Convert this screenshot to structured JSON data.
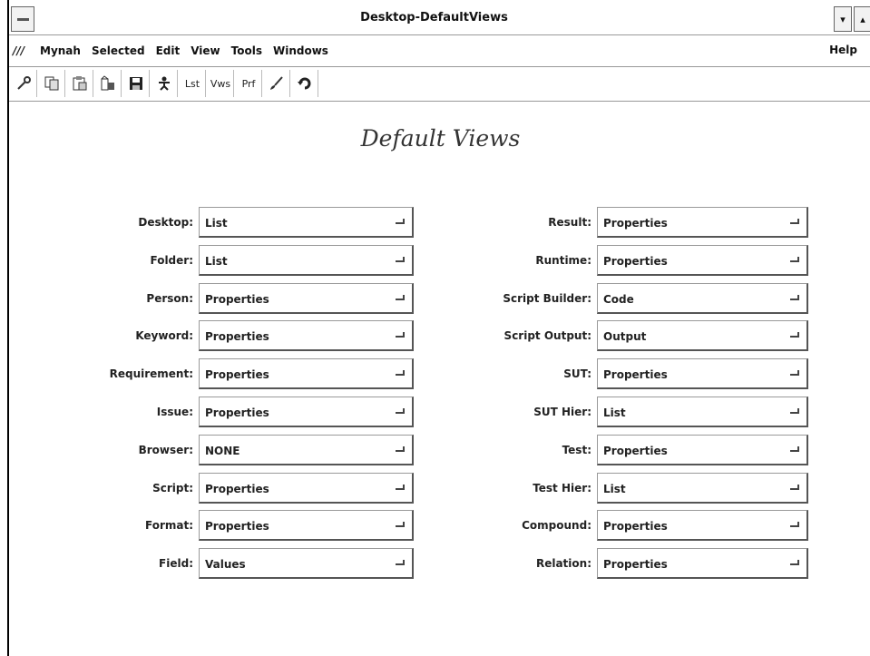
{
  "window": {
    "title": "Desktop-DefaultViews"
  },
  "menubar": {
    "glyph": "///",
    "items": [
      "Mynah",
      "Selected",
      "Edit",
      "View",
      "Tools",
      "Windows"
    ],
    "help": "Help"
  },
  "toolbar": {
    "tools": [
      {
        "icon": "wrench-icon"
      },
      {
        "icon": "copy-icon"
      },
      {
        "icon": "paste-icon"
      },
      {
        "icon": "building-icon"
      },
      {
        "icon": "save-icon"
      },
      {
        "icon": "person-icon"
      },
      {
        "label": "Lst"
      },
      {
        "label": "Vws"
      },
      {
        "label": "Prf"
      },
      {
        "icon": "brush-icon"
      },
      {
        "icon": "refresh-icon"
      }
    ]
  },
  "heading": "Default Views",
  "left_fields": [
    {
      "label": "Desktop:",
      "value": "List"
    },
    {
      "label": "Folder:",
      "value": "List"
    },
    {
      "label": "Person:",
      "value": "Properties"
    },
    {
      "label": "Keyword:",
      "value": "Properties"
    },
    {
      "label": "Requirement:",
      "value": "Properties"
    },
    {
      "label": "Issue:",
      "value": "Properties"
    },
    {
      "label": "Browser:",
      "value": "NONE"
    },
    {
      "label": "Script:",
      "value": "Properties"
    },
    {
      "label": "Format:",
      "value": "Properties"
    },
    {
      "label": "Field:",
      "value": "Values"
    }
  ],
  "right_fields": [
    {
      "label": "Result:",
      "value": "Properties"
    },
    {
      "label": "Runtime:",
      "value": "Properties"
    },
    {
      "label": "Script Builder:",
      "value": "Code"
    },
    {
      "label": "Script Output:",
      "value": "Output"
    },
    {
      "label": "SUT:",
      "value": "Properties"
    },
    {
      "label": "SUT Hier:",
      "value": "List"
    },
    {
      "label": "Test:",
      "value": "Properties"
    },
    {
      "label": "Test Hier:",
      "value": "List"
    },
    {
      "label": "Compound:",
      "value": "Properties"
    },
    {
      "label": "Relation:",
      "value": "Properties"
    }
  ]
}
